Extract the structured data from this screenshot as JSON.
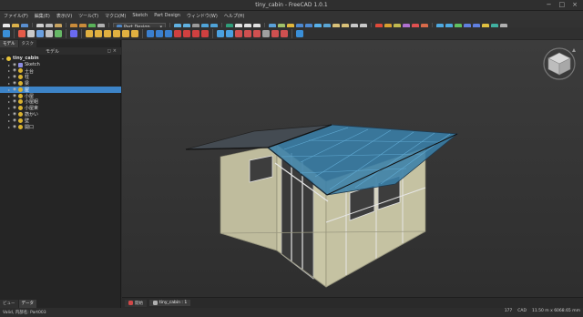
{
  "window": {
    "title": "tiny_cabin - FreeCAD 1.0.1"
  },
  "menu": [
    "ファイル(F)",
    "編集(E)",
    "表示(V)",
    "ツール(T)",
    "マクロ(M)",
    "Sketch",
    "Part Design",
    "ウィンドウ(W)",
    "ヘルプ(H)"
  ],
  "toolbar": {
    "workbench_label": "Part Design"
  },
  "panel": {
    "tabs": [
      "モデル",
      "タスク"
    ],
    "header": "モデル",
    "bottom_tabs": [
      "ビュー",
      "データ"
    ],
    "tree": [
      {
        "label": "tiny_cabin",
        "type": "root",
        "selected": false
      },
      {
        "label": "Sketch",
        "type": "sketch",
        "selected": false
      },
      {
        "label": "土台",
        "type": "part",
        "selected": false
      },
      {
        "label": "柱",
        "type": "part",
        "selected": false
      },
      {
        "label": "梁",
        "type": "part",
        "selected": false
      },
      {
        "label": "屋",
        "type": "part",
        "selected": true
      },
      {
        "label": "小屋",
        "type": "part",
        "selected": false
      },
      {
        "label": "小屋組",
        "type": "part",
        "selected": false
      },
      {
        "label": "小屋束",
        "type": "part",
        "selected": false
      },
      {
        "label": "筋かい",
        "type": "part",
        "selected": false
      },
      {
        "label": "壁",
        "type": "part",
        "selected": false
      },
      {
        "label": "開口",
        "type": "part",
        "selected": false
      }
    ]
  },
  "doc_tabs": [
    {
      "label": "開始",
      "active": false
    },
    {
      "label": "tiny_cabin : 1",
      "active": true
    }
  ],
  "status": {
    "message": "Valid, 内部名: Part003",
    "right": [
      "177",
      "CAD",
      "11.50 m x 6068.65 mm"
    ]
  },
  "colors": {
    "accent": "#3d84c8",
    "roof": "#3a7fa8",
    "wall": "#c9c6a6",
    "frame": "#d8d8d8"
  }
}
